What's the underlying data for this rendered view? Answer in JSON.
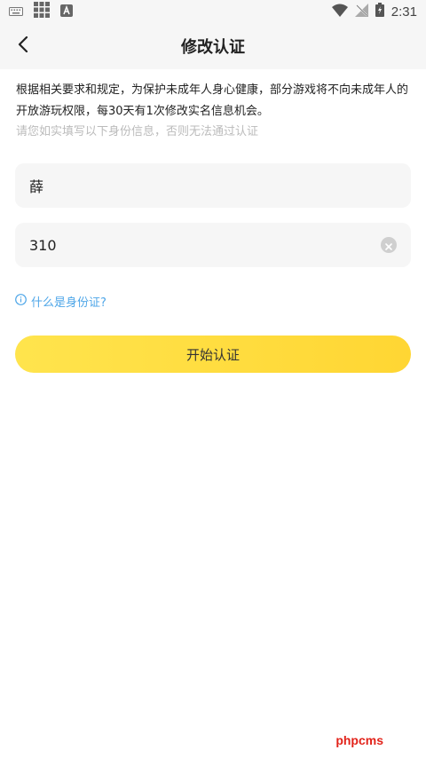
{
  "status_bar": {
    "time": "2:31",
    "icons": [
      "keyboard-icon",
      "grid-icon",
      "a-badge-icon",
      "wifi-icon",
      "no-signal-icon",
      "battery-charging-icon"
    ]
  },
  "header": {
    "title": "修改认证",
    "back_icon": "chevron-left-icon"
  },
  "notice": {
    "text": "根据相关要求和规定，为保护未成年人身心健康，部分游戏将不向未成年人的开放游玩权限，每30天有1次修改实名信息机会。",
    "hint": "请您如实填写以下身份信息，否则无法通过认证"
  },
  "form": {
    "name_value": "薛",
    "id_value": "310"
  },
  "help": {
    "label": "什么是身份证?",
    "icon": "info-circle-icon"
  },
  "actions": {
    "start_label": "开始认证",
    "accent": "#ffdd3c"
  },
  "watermark": {
    "text": "phpcms"
  }
}
